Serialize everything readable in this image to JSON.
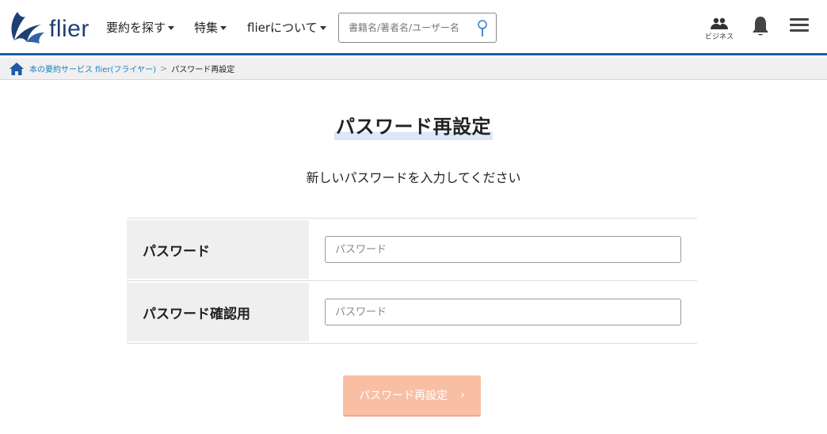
{
  "header": {
    "logo_text": "flier",
    "nav": [
      {
        "label": "要約を探す"
      },
      {
        "label": "特集"
      },
      {
        "label": "flierについて"
      }
    ],
    "search": {
      "placeholder": "書籍名/著者名/ユーザー名",
      "value": ""
    },
    "business_label": "ビジネス",
    "icons": {
      "business": "people-icon",
      "notification": "bell-icon",
      "menu": "hamburger-icon",
      "search": "search-icon"
    }
  },
  "breadcrumb": {
    "home_link": "本の要約サービス flier(フライヤー)",
    "separator": ">",
    "current": "パスワード再設定"
  },
  "main": {
    "title": "パスワード再設定",
    "subtitle": "新しいパスワードを入力してください",
    "fields": [
      {
        "label": "パスワード",
        "placeholder": "パスワード",
        "value": ""
      },
      {
        "label": "パスワード確認用",
        "placeholder": "パスワード",
        "value": ""
      }
    ],
    "submit_label": "パスワード再設定",
    "submit_chevron": "›"
  },
  "colors": {
    "brand_blue": "#1e5aa6",
    "link_blue": "#1a7fc2",
    "button_disabled": "#f9bfa5",
    "label_bg": "#efefef"
  }
}
